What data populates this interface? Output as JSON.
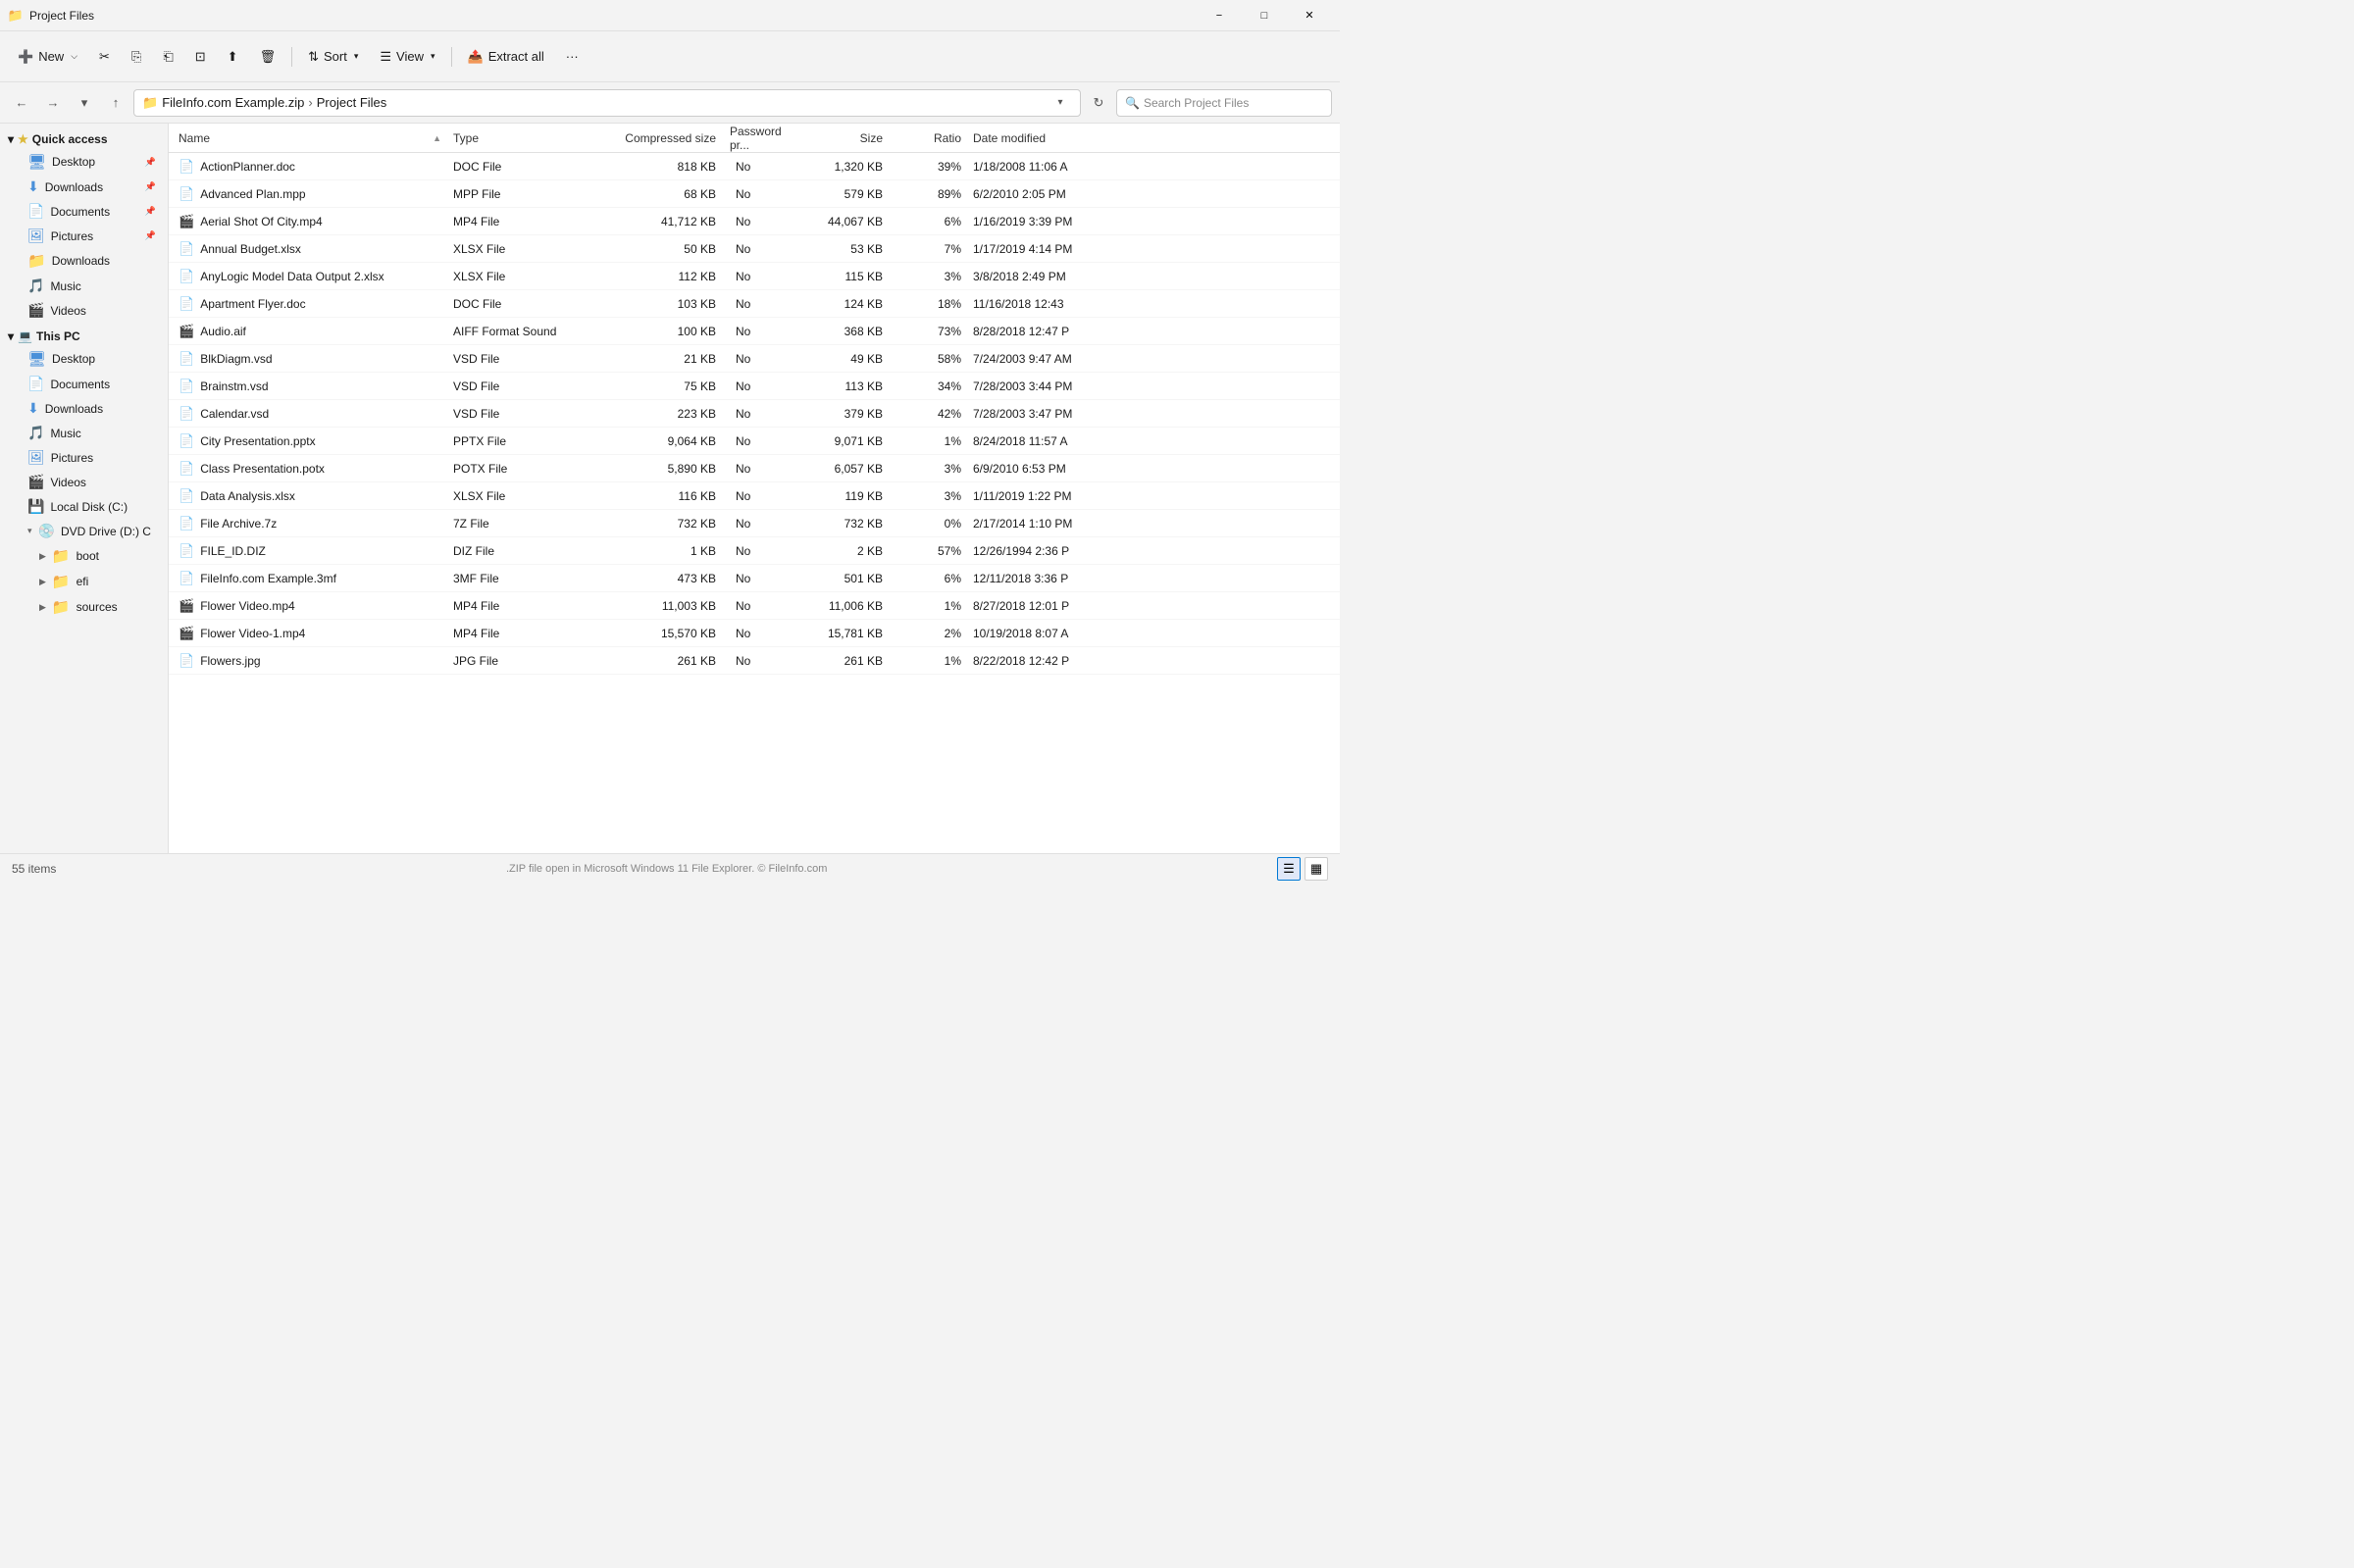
{
  "titlebar": {
    "title": "Project Files",
    "icon": "📁"
  },
  "toolbar": {
    "new_label": "New",
    "sort_label": "Sort",
    "view_label": "View",
    "extract_label": "Extract all",
    "more_label": "···"
  },
  "addressbar": {
    "path_parts": [
      "FileInfo.com Example.zip",
      "Project Files"
    ],
    "search_placeholder": "Search Project Files"
  },
  "sidebar": {
    "quick_access_label": "Quick access",
    "items_quick": [
      {
        "label": "Desktop",
        "type": "desktop",
        "pinned": true
      },
      {
        "label": "Downloads",
        "type": "download",
        "pinned": true
      },
      {
        "label": "Documents",
        "type": "doc",
        "pinned": true
      },
      {
        "label": "Pictures",
        "type": "pic",
        "pinned": true
      },
      {
        "label": "Downloads",
        "type": "folder"
      },
      {
        "label": "Music",
        "type": "music"
      },
      {
        "label": "Videos",
        "type": "video"
      }
    ],
    "thispc_label": "This PC",
    "items_pc": [
      {
        "label": "Desktop",
        "type": "desktop"
      },
      {
        "label": "Documents",
        "type": "doc"
      },
      {
        "label": "Downloads",
        "type": "download"
      },
      {
        "label": "Music",
        "type": "music"
      },
      {
        "label": "Pictures",
        "type": "pic"
      },
      {
        "label": "Videos",
        "type": "video"
      },
      {
        "label": "Local Disk (C:)",
        "type": "drive"
      },
      {
        "label": "DVD Drive (D:) C",
        "type": "dvd",
        "expanded": true
      }
    ],
    "dvd_children": [
      {
        "label": "boot"
      },
      {
        "label": "efi"
      },
      {
        "label": "sources"
      }
    ]
  },
  "columns": {
    "name": "Name",
    "type": "Type",
    "compressed_size": "Compressed size",
    "password_protected": "Password pr...",
    "size": "Size",
    "ratio": "Ratio",
    "date_modified": "Date modified"
  },
  "files": [
    {
      "name": "ActionPlanner.doc",
      "type": "DOC File",
      "compressed": "818 KB",
      "password": "No",
      "size": "1,320 KB",
      "ratio": "39%",
      "date": "1/18/2008 11:06 A",
      "icon": "doc"
    },
    {
      "name": "Advanced Plan.mpp",
      "type": "MPP File",
      "compressed": "68 KB",
      "password": "No",
      "size": "579 KB",
      "ratio": "89%",
      "date": "6/2/2010 2:05 PM",
      "icon": "doc"
    },
    {
      "name": "Aerial Shot Of City.mp4",
      "type": "MP4 File",
      "compressed": "41,712 KB",
      "password": "No",
      "size": "44,067 KB",
      "ratio": "6%",
      "date": "1/16/2019 3:39 PM",
      "icon": "mp4"
    },
    {
      "name": "Annual Budget.xlsx",
      "type": "XLSX File",
      "compressed": "50 KB",
      "password": "No",
      "size": "53 KB",
      "ratio": "7%",
      "date": "1/17/2019 4:14 PM",
      "icon": "doc"
    },
    {
      "name": "AnyLogic Model Data Output 2.xlsx",
      "type": "XLSX File",
      "compressed": "112 KB",
      "password": "No",
      "size": "115 KB",
      "ratio": "3%",
      "date": "3/8/2018 2:49 PM",
      "icon": "doc"
    },
    {
      "name": "Apartment Flyer.doc",
      "type": "DOC File",
      "compressed": "103 KB",
      "password": "No",
      "size": "124 KB",
      "ratio": "18%",
      "date": "11/16/2018 12:43",
      "icon": "doc"
    },
    {
      "name": "Audio.aif",
      "type": "AIFF Format Sound",
      "compressed": "100 KB",
      "password": "No",
      "size": "368 KB",
      "ratio": "73%",
      "date": "8/28/2018 12:47 P",
      "icon": "mp4"
    },
    {
      "name": "BlkDiagm.vsd",
      "type": "VSD File",
      "compressed": "21 KB",
      "password": "No",
      "size": "49 KB",
      "ratio": "58%",
      "date": "7/24/2003 9:47 AM",
      "icon": "doc"
    },
    {
      "name": "Brainstm.vsd",
      "type": "VSD File",
      "compressed": "75 KB",
      "password": "No",
      "size": "113 KB",
      "ratio": "34%",
      "date": "7/28/2003 3:44 PM",
      "icon": "doc"
    },
    {
      "name": "Calendar.vsd",
      "type": "VSD File",
      "compressed": "223 KB",
      "password": "No",
      "size": "379 KB",
      "ratio": "42%",
      "date": "7/28/2003 3:47 PM",
      "icon": "doc"
    },
    {
      "name": "City Presentation.pptx",
      "type": "PPTX File",
      "compressed": "9,064 KB",
      "password": "No",
      "size": "9,071 KB",
      "ratio": "1%",
      "date": "8/24/2018 11:57 A",
      "icon": "doc"
    },
    {
      "name": "Class Presentation.potx",
      "type": "POTX File",
      "compressed": "5,890 KB",
      "password": "No",
      "size": "6,057 KB",
      "ratio": "3%",
      "date": "6/9/2010 6:53 PM",
      "icon": "doc"
    },
    {
      "name": "Data Analysis.xlsx",
      "type": "XLSX File",
      "compressed": "116 KB",
      "password": "No",
      "size": "119 KB",
      "ratio": "3%",
      "date": "1/11/2019 1:22 PM",
      "icon": "doc"
    },
    {
      "name": "File Archive.7z",
      "type": "7Z File",
      "compressed": "732 KB",
      "password": "No",
      "size": "732 KB",
      "ratio": "0%",
      "date": "2/17/2014 1:10 PM",
      "icon": "doc"
    },
    {
      "name": "FILE_ID.DIZ",
      "type": "DIZ File",
      "compressed": "1 KB",
      "password": "No",
      "size": "2 KB",
      "ratio": "57%",
      "date": "12/26/1994 2:36 P",
      "icon": "doc"
    },
    {
      "name": "FileInfo.com Example.3mf",
      "type": "3MF File",
      "compressed": "473 KB",
      "password": "No",
      "size": "501 KB",
      "ratio": "6%",
      "date": "12/11/2018 3:36 P",
      "icon": "doc"
    },
    {
      "name": "Flower Video.mp4",
      "type": "MP4 File",
      "compressed": "11,003 KB",
      "password": "No",
      "size": "11,006 KB",
      "ratio": "1%",
      "date": "8/27/2018 12:01 P",
      "icon": "mp4"
    },
    {
      "name": "Flower Video-1.mp4",
      "type": "MP4 File",
      "compressed": "15,570 KB",
      "password": "No",
      "size": "15,781 KB",
      "ratio": "2%",
      "date": "10/19/2018 8:07 A",
      "icon": "mp4"
    },
    {
      "name": "Flowers.jpg",
      "type": "JPG File",
      "compressed": "261 KB",
      "password": "No",
      "size": "261 KB",
      "ratio": "1%",
      "date": "8/22/2018 12:42 P",
      "icon": "doc"
    }
  ],
  "statusbar": {
    "items_count": "55 items",
    "footer_text": ".ZIP file open in Microsoft Windows 11 File Explorer. © FileInfo.com"
  }
}
